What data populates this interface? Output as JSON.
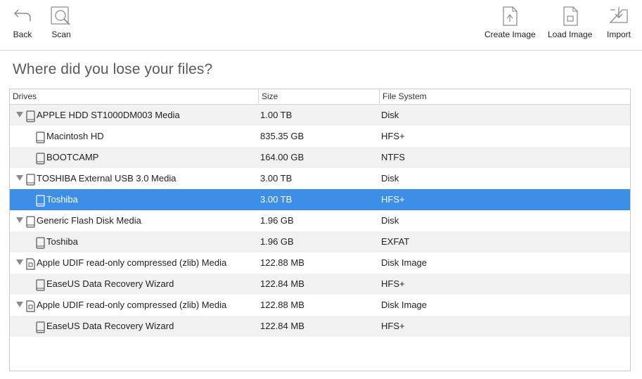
{
  "toolbar": {
    "back_label": "Back",
    "scan_label": "Scan",
    "create_image_label": "Create Image",
    "load_image_label": "Load Image",
    "import_label": "Import"
  },
  "page": {
    "title": "Where did you lose your files?"
  },
  "table": {
    "columns": {
      "drives": "Drives",
      "size": "Size",
      "file_system": "File System"
    },
    "rows": [
      {
        "name": "APPLE HDD ST1000DM003 Media",
        "size": "1.00 TB",
        "fs": "Disk",
        "level": 0,
        "icon": "drive-icon"
      },
      {
        "name": "Macintosh HD",
        "size": "835.35 GB",
        "fs": "HFS+",
        "level": 1,
        "icon": "partition-icon"
      },
      {
        "name": "BOOTCAMP",
        "size": "164.00 GB",
        "fs": "NTFS",
        "level": 1,
        "icon": "partition-icon"
      },
      {
        "name": "TOSHIBA External USB 3.0 Media",
        "size": "3.00 TB",
        "fs": "Disk",
        "level": 0,
        "icon": "drive-icon"
      },
      {
        "name": "Toshiba",
        "size": "3.00 TB",
        "fs": "HFS+",
        "level": 1,
        "icon": "partition-icon",
        "selected": true
      },
      {
        "name": "Generic Flash Disk Media",
        "size": "1.96 GB",
        "fs": "Disk",
        "level": 0,
        "icon": "drive-icon"
      },
      {
        "name": "Toshiba",
        "size": "1.96 GB",
        "fs": "EXFAT",
        "level": 1,
        "icon": "partition-icon"
      },
      {
        "name": "Apple UDIF read-only compressed (zlib) Media",
        "size": "122.88 MB",
        "fs": "Disk Image",
        "level": 0,
        "icon": "disk-image-icon"
      },
      {
        "name": "EaseUS Data Recovery Wizard",
        "size": "122.84 MB",
        "fs": "HFS+",
        "level": 1,
        "icon": "partition-icon"
      },
      {
        "name": "Apple UDIF read-only compressed (zlib) Media",
        "size": "122.88 MB",
        "fs": "Disk Image",
        "level": 0,
        "icon": "disk-image-icon"
      },
      {
        "name": "EaseUS Data Recovery Wizard",
        "size": "122.84 MB",
        "fs": "HFS+",
        "level": 1,
        "icon": "partition-icon"
      }
    ]
  },
  "colors": {
    "selection": "#3d8ee7",
    "row_alt": "#f2f2f2",
    "title": "#5a5a5a"
  }
}
